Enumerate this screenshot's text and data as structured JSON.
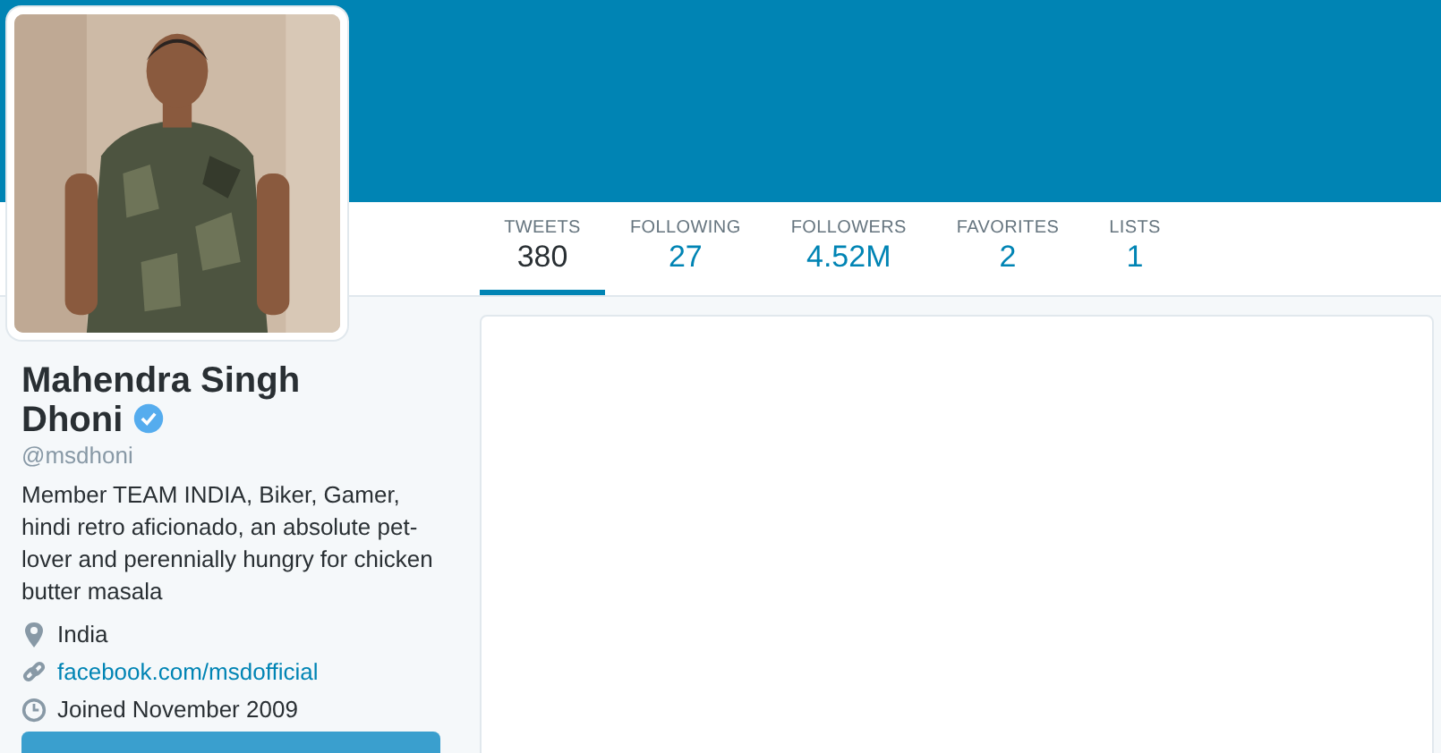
{
  "profile_nav": {
    "stats": [
      {
        "label": "TWEETS",
        "value": "380",
        "selected": true
      },
      {
        "label": "FOLLOWING",
        "value": "27",
        "selected": false
      },
      {
        "label": "FOLLOWERS",
        "value": "4.52M",
        "selected": false
      },
      {
        "label": "FAVORITES",
        "value": "2",
        "selected": false
      },
      {
        "label": "LISTS",
        "value": "1",
        "selected": false
      }
    ]
  },
  "profile": {
    "name": "Mahendra Singh Dhoni",
    "verified": true,
    "handle": "@msdhoni",
    "bio": "Member TEAM INDIA, Biker, Gamer, hindi retro aficionado, an absolute pet-lover and perennially hungry for chicken butter masala",
    "details": [
      {
        "kind": "location",
        "text": "India"
      },
      {
        "kind": "link",
        "text": "facebook.com/msdofficial"
      },
      {
        "kind": "joined",
        "text": "Joined November 2009"
      }
    ]
  }
}
